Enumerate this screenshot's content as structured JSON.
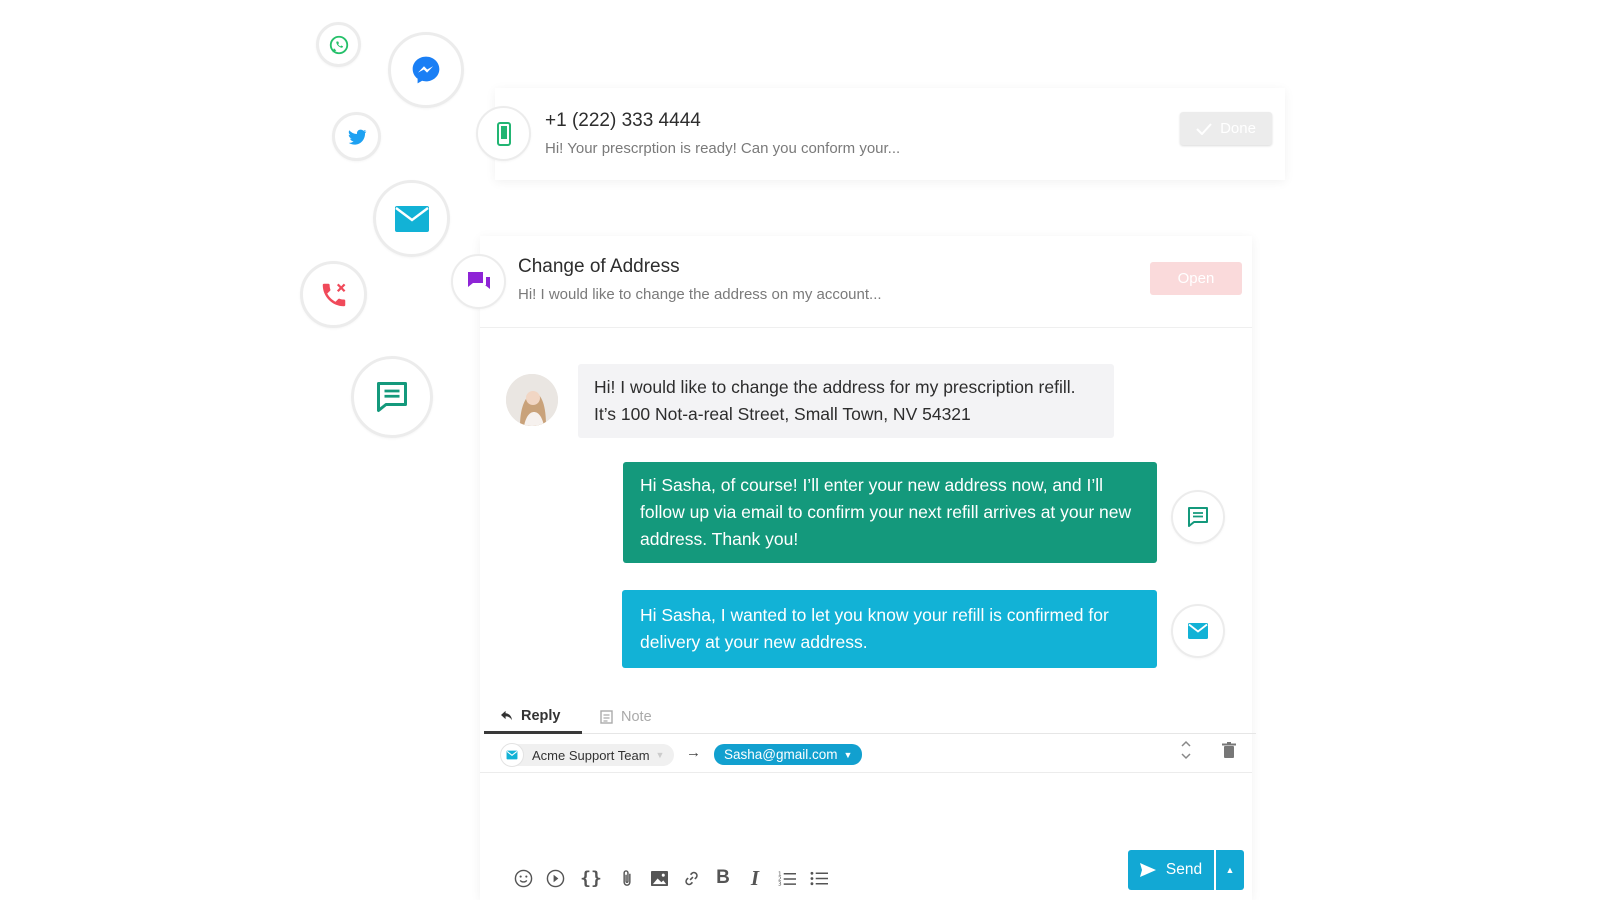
{
  "channels": [
    "whatsapp-icon",
    "messenger-icon",
    "twitter-icon",
    "email-icon",
    "phone-icon",
    "chat-icon"
  ],
  "conversations": [
    {
      "channel_icon": "mobile-phone-icon",
      "title": "+1 (222) 333 4444",
      "snippet": "Hi! Your prescrption is ready! Can you conform your...",
      "action_label": "Done"
    },
    {
      "channel_icon": "chat-bubbles-icon",
      "title": "Change of Address",
      "snippet": "Hi! I would like to change the address on my account...",
      "action_label": "Open"
    }
  ],
  "thread": [
    {
      "from": "customer",
      "text": "Hi! I would like to change the address for my prescription refill. It’s 100 Not-a-real Street, Small Town, NV 54321"
    },
    {
      "from": "agent",
      "channel": "chat",
      "text": "Hi Sasha, of course! I’ll enter your new address now, and I’ll follow up via email to confirm your next refill arrives at your new address. Thank you!"
    },
    {
      "from": "agent",
      "channel": "email",
      "text": "Hi Sasha, I wanted to let you know your refill is confirmed for delivery at your new address."
    }
  ],
  "composer": {
    "tabs": {
      "reply": "Reply",
      "note": "Note"
    },
    "from": "Acme Support Team",
    "to": "Sasha@gmail.com",
    "send_label": "Send"
  },
  "colors": {
    "agent_chat": "#14997c",
    "agent_email": "#12b2d6",
    "accent": "#12a8d4",
    "open_button": "#fadadb"
  }
}
